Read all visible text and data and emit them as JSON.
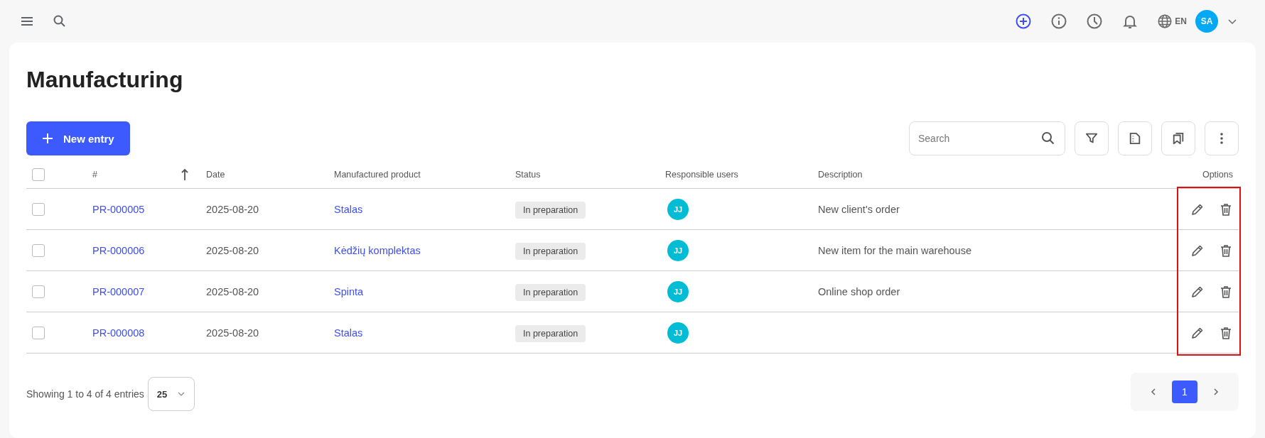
{
  "topbar": {
    "language": "EN",
    "avatar_initials": "SA"
  },
  "page": {
    "title": "Manufacturing",
    "new_button": "New entry",
    "search": {
      "placeholder": "Search"
    }
  },
  "table": {
    "columns": [
      "#",
      "Date",
      "Manufactured product",
      "Status",
      "Responsible users",
      "Description",
      "Options"
    ],
    "sort_ascending": true,
    "all_checked": false,
    "options_highlighted": true,
    "rows": [
      {
        "number": "PR-000005",
        "date": "2025-08-20",
        "product": "Stalas",
        "status": "In preparation",
        "user_initials": "JJ",
        "description": "New client's order",
        "checked": false
      },
      {
        "number": "PR-000006",
        "date": "2025-08-20",
        "product": "Kėdžių komplektas",
        "status": "In preparation",
        "user_initials": "JJ",
        "description": "New item for the main warehouse",
        "checked": false
      },
      {
        "number": "PR-000007",
        "date": "2025-08-20",
        "product": "Spinta",
        "status": "In preparation",
        "user_initials": "JJ",
        "description": "Online shop order",
        "checked": false
      },
      {
        "number": "PR-000008",
        "date": "2025-08-20",
        "product": "Stalas",
        "status": "In preparation",
        "user_initials": "JJ",
        "checked": false
      }
    ]
  },
  "footer": {
    "summary": "Showing 1 to 4 of 4 entries",
    "page_size": "25",
    "pages": [
      {
        "label": "1",
        "selected": true
      }
    ]
  }
}
